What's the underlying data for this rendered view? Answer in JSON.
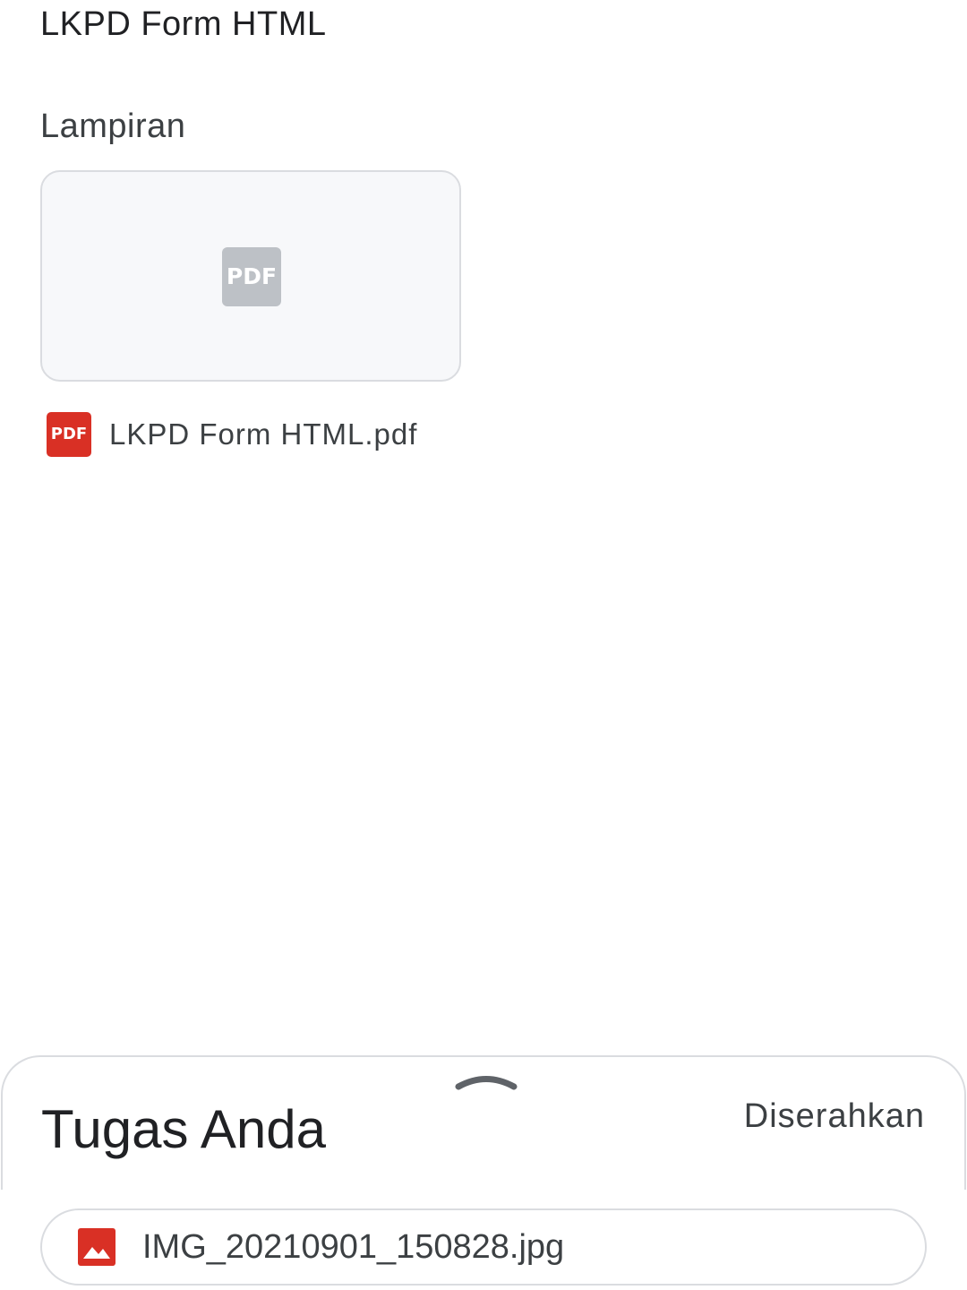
{
  "assignment": {
    "description": "LKPD Form HTML"
  },
  "attachments": {
    "section_title": "Lampiran",
    "items": [
      {
        "thumbnail_icon": "pdf-icon",
        "thumbnail_label": "PDF",
        "type_icon": "pdf-icon",
        "type_label": "PDF",
        "file_name": "LKPD Form HTML.pdf"
      }
    ]
  },
  "your_work": {
    "handle_icon": "chevron-up-icon",
    "title": "Tugas Anda",
    "status": "Diserahkan",
    "files": [
      {
        "icon": "image-icon",
        "file_name": "IMG_20210901_150828.jpg"
      }
    ]
  },
  "colors": {
    "pdf_red": "#d93025",
    "pdf_gray": "#bdc1c6",
    "border": "#dadce0"
  }
}
